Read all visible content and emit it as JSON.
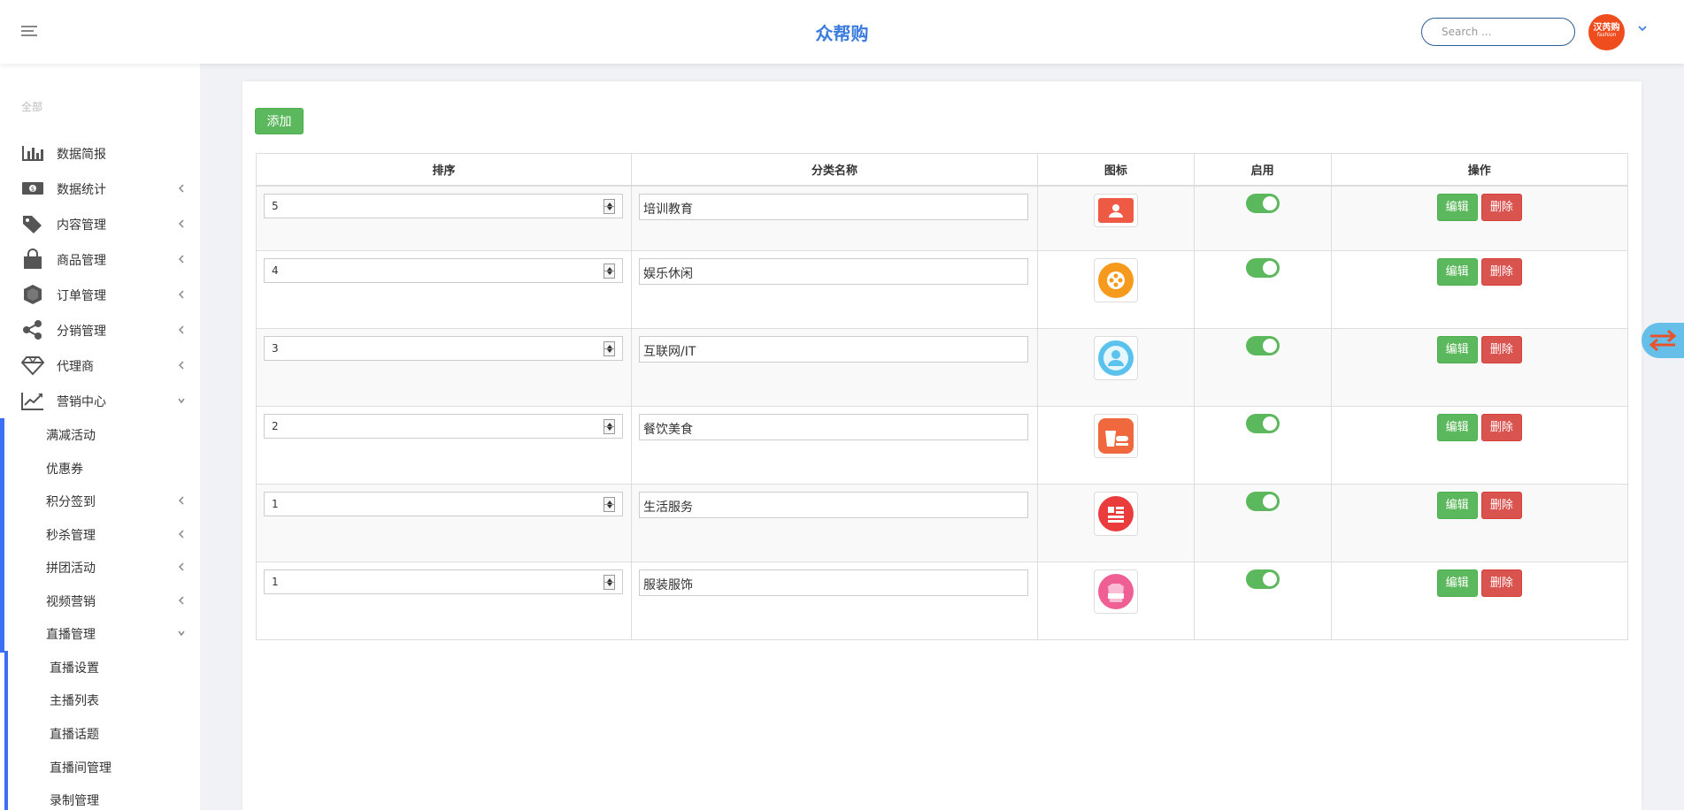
{
  "header": {
    "brand": "众帮购",
    "search_placeholder": "Search ...",
    "avatar_text": "汉芮购",
    "avatar_sub": "fashion"
  },
  "sidebar": {
    "all_label": "全部",
    "items": [
      {
        "label": "数据简报"
      },
      {
        "label": "数据统计"
      },
      {
        "label": "内容管理"
      },
      {
        "label": "商品管理"
      },
      {
        "label": "订单管理"
      },
      {
        "label": "分销管理"
      },
      {
        "label": "代理商"
      },
      {
        "label": "营销中心"
      }
    ],
    "marketing_sub": [
      {
        "label": "满减活动"
      },
      {
        "label": "优惠券"
      },
      {
        "label": "积分签到"
      },
      {
        "label": "秒杀管理"
      },
      {
        "label": "拼团活动"
      },
      {
        "label": "视频营销"
      },
      {
        "label": "直播管理"
      }
    ],
    "live_sub": [
      {
        "label": "直播设置"
      },
      {
        "label": "主播列表"
      },
      {
        "label": "直播话题"
      },
      {
        "label": "直播间管理"
      },
      {
        "label": "录制管理"
      }
    ]
  },
  "main": {
    "add_label": "添加",
    "columns": [
      "排序",
      "分类名称",
      "图标",
      "启用",
      "操作"
    ],
    "edit_label": "编辑",
    "delete_label": "删除",
    "rows": [
      {
        "sort": "5",
        "name": "培训教育",
        "icon": "person-card-icon",
        "enabled": true
      },
      {
        "sort": "4",
        "name": "娱乐休闲",
        "icon": "film-reel-icon",
        "enabled": true
      },
      {
        "sort": "3",
        "name": "互联网/IT",
        "icon": "user-circle-icon",
        "enabled": true
      },
      {
        "sort": "2",
        "name": "餐饮美食",
        "icon": "food-drink-icon",
        "enabled": true
      },
      {
        "sort": "1",
        "name": "生活服务",
        "icon": "service-list-icon",
        "enabled": true
      },
      {
        "sort": "1",
        "name": "服装服饰",
        "icon": "clothing-icon",
        "enabled": true
      }
    ]
  },
  "colors": {
    "brand": "#3a7be0",
    "accent_blue": "#3b6ff5",
    "success": "#5cb85c",
    "danger": "#d9534f"
  }
}
